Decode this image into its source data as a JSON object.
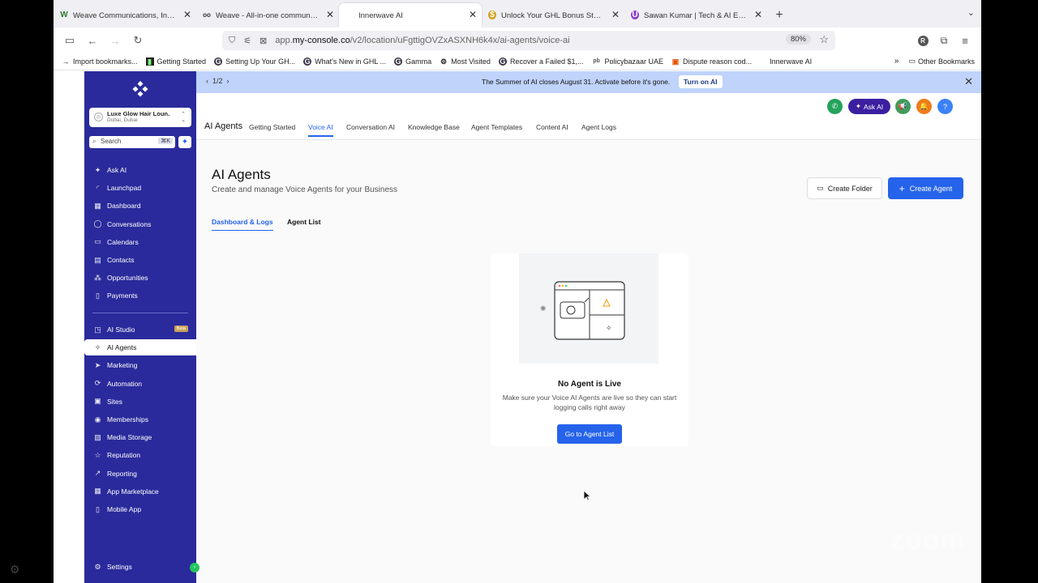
{
  "browser": {
    "tabs": [
      {
        "label": "Weave Communications, Inc. (W",
        "icon": "W"
      },
      {
        "label": "Weave - All-in-one communicati",
        "icon": "oo"
      },
      {
        "label": "Innerwave AI",
        "icon": ""
      },
      {
        "label": "Unlock Your GHL Bonus Stack -",
        "icon": "$"
      },
      {
        "label": "Sawan Kumar | Tech & AI Educat",
        "icon": "U"
      }
    ],
    "url_prefix": "app.",
    "url_host": "my-console.co",
    "url_path": "/v2/location/uFgttigOVZxASXNH6k4x/ai-agents/voice-ai",
    "zoom": "80%",
    "profile_initial": "R",
    "bookmarks": [
      {
        "label": "Import bookmarks...",
        "icon": "→"
      },
      {
        "label": "Getting Started",
        "icon": "▮"
      },
      {
        "label": "Setting Up Your GH...",
        "icon": "G"
      },
      {
        "label": "What's New in GHL ...",
        "icon": "G"
      },
      {
        "label": "Gamma",
        "icon": "G"
      },
      {
        "label": "Most Visited",
        "icon": "⚙"
      },
      {
        "label": "Recover a Failed $1,...",
        "icon": "G"
      },
      {
        "label": "Policybazaar UAE",
        "icon": "pb"
      },
      {
        "label": "Dispute reason cod...",
        "icon": "▣"
      },
      {
        "label": "Innerwave AI",
        "icon": ""
      }
    ],
    "other_bookmarks": "Other Bookmarks"
  },
  "sidebar": {
    "location_name": "Luxe Glow Hair Loun...",
    "location_sub": "Dubai, Dubai",
    "search_placeholder": "Search",
    "search_shortcut": "⌘K",
    "items": [
      {
        "label": "Ask AI",
        "icon": "✦"
      },
      {
        "label": "Launchpad",
        "icon": "◜"
      },
      {
        "label": "Dashboard",
        "icon": "▦"
      },
      {
        "label": "Conversations",
        "icon": "◯"
      },
      {
        "label": "Calendars",
        "icon": "▭"
      },
      {
        "label": "Contacts",
        "icon": "▤"
      },
      {
        "label": "Opportunities",
        "icon": "⁂"
      },
      {
        "label": "Payments",
        "icon": "▯"
      }
    ],
    "items2": [
      {
        "label": "AI Studio",
        "icon": "◳",
        "badge": "Beta"
      },
      {
        "label": "AI Agents",
        "icon": "✧",
        "active": true
      },
      {
        "label": "Marketing",
        "icon": "➤"
      },
      {
        "label": "Automation",
        "icon": "⟳"
      },
      {
        "label": "Sites",
        "icon": "▣"
      },
      {
        "label": "Memberships",
        "icon": "◉"
      },
      {
        "label": "Media Storage",
        "icon": "▨"
      },
      {
        "label": "Reputation",
        "icon": "☆"
      },
      {
        "label": "Reporting",
        "icon": "↗"
      },
      {
        "label": "App Marketplace",
        "icon": "▦"
      },
      {
        "label": "Mobile App",
        "icon": "▯"
      }
    ],
    "settings": "Settings"
  },
  "banner": {
    "pager": "1/2",
    "message": "The Summer of AI closes August 31. Activate before it's gone.",
    "button": "Turn on AI"
  },
  "header": {
    "title": "AI Agents",
    "tabs": [
      "Getting Started",
      "Voice AI",
      "Conversation AI",
      "Knowledge Base",
      "Agent Templates",
      "Content AI",
      "Agent Logs"
    ],
    "active_tab": "Voice AI",
    "ask_ai": "Ask AI"
  },
  "main": {
    "title": "AI Agents",
    "subtitle": "Create and manage Voice Agents for your Business",
    "create_folder": "Create Folder",
    "create_agent": "Create Agent",
    "subtabs": [
      "Dashboard & Logs",
      "Agent List"
    ],
    "empty_title": "No Agent is Live",
    "empty_desc": "Make sure your Voice AI Agents are live so they can start logging calls right away",
    "goto_button": "Go to Agent List"
  },
  "colors": {
    "sidebar": "#2a2a9c",
    "accent": "#2563eb",
    "banner": "#bfd3fb"
  }
}
